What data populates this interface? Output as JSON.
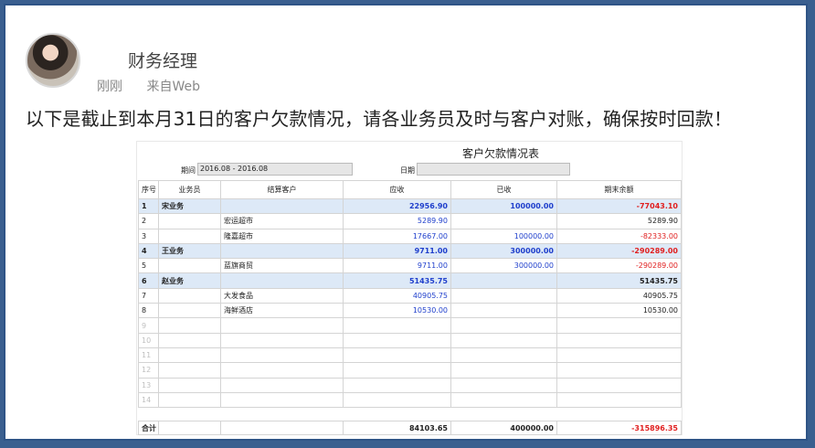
{
  "post": {
    "user_name": "财务经理",
    "time": "刚刚",
    "source": "来自Web",
    "text": "以下是截止到本月31日的客户欠款情况，请各业务员及时与客户对账，确保按时回款！"
  },
  "report": {
    "title": "客户欠款情况表",
    "period_label": "期间",
    "period_value": "2016.08 - 2016.08",
    "date_label": "日期",
    "date_value": "",
    "columns": [
      "序号",
      "业务员",
      "结算客户",
      "应收",
      "已收",
      "期末余额"
    ],
    "rows": [
      {
        "seq": "1",
        "salesperson": "宋业务",
        "customer": "",
        "receivable": "22956.90",
        "received": "100000.00",
        "balance": "-77043.10",
        "type": "group"
      },
      {
        "seq": "2",
        "salesperson": "",
        "customer": "宏运超市",
        "receivable": "5289.90",
        "received": "",
        "balance": "5289.90",
        "type": "detail"
      },
      {
        "seq": "3",
        "salesperson": "",
        "customer": "隆嘉超市",
        "receivable": "17667.00",
        "received": "100000.00",
        "balance": "-82333.00",
        "type": "detail"
      },
      {
        "seq": "4",
        "salesperson": "王业务",
        "customer": "",
        "receivable": "9711.00",
        "received": "300000.00",
        "balance": "-290289.00",
        "type": "group"
      },
      {
        "seq": "5",
        "salesperson": "",
        "customer": "蓝旗商贸",
        "receivable": "9711.00",
        "received": "300000.00",
        "balance": "-290289.00",
        "type": "detail"
      },
      {
        "seq": "6",
        "salesperson": "赵业务",
        "customer": "",
        "receivable": "51435.75",
        "received": "",
        "balance": "51435.75",
        "type": "group"
      },
      {
        "seq": "7",
        "salesperson": "",
        "customer": "大发食品",
        "receivable": "40905.75",
        "received": "",
        "balance": "40905.75",
        "type": "detail"
      },
      {
        "seq": "8",
        "salesperson": "",
        "customer": "海鲜酒店",
        "receivable": "10530.00",
        "received": "",
        "balance": "10530.00",
        "type": "detail"
      },
      {
        "seq": "9",
        "salesperson": "",
        "customer": "",
        "receivable": "",
        "received": "",
        "balance": "",
        "type": "empty"
      },
      {
        "seq": "10",
        "salesperson": "",
        "customer": "",
        "receivable": "",
        "received": "",
        "balance": "",
        "type": "empty"
      },
      {
        "seq": "11",
        "salesperson": "",
        "customer": "",
        "receivable": "",
        "received": "",
        "balance": "",
        "type": "empty"
      },
      {
        "seq": "12",
        "salesperson": "",
        "customer": "",
        "receivable": "",
        "received": "",
        "balance": "",
        "type": "empty"
      },
      {
        "seq": "13",
        "salesperson": "",
        "customer": "",
        "receivable": "",
        "received": "",
        "balance": "",
        "type": "empty"
      },
      {
        "seq": "14",
        "salesperson": "",
        "customer": "",
        "receivable": "",
        "received": "",
        "balance": "",
        "type": "empty"
      }
    ],
    "total": {
      "label": "合计",
      "receivable": "84103.65",
      "received": "400000.00",
      "balance": "-315896.35"
    },
    "colors": {
      "group_row_bg": "#dde9f7",
      "receivable_text": "#1f3fcc",
      "negative_text": "#e02020"
    }
  }
}
